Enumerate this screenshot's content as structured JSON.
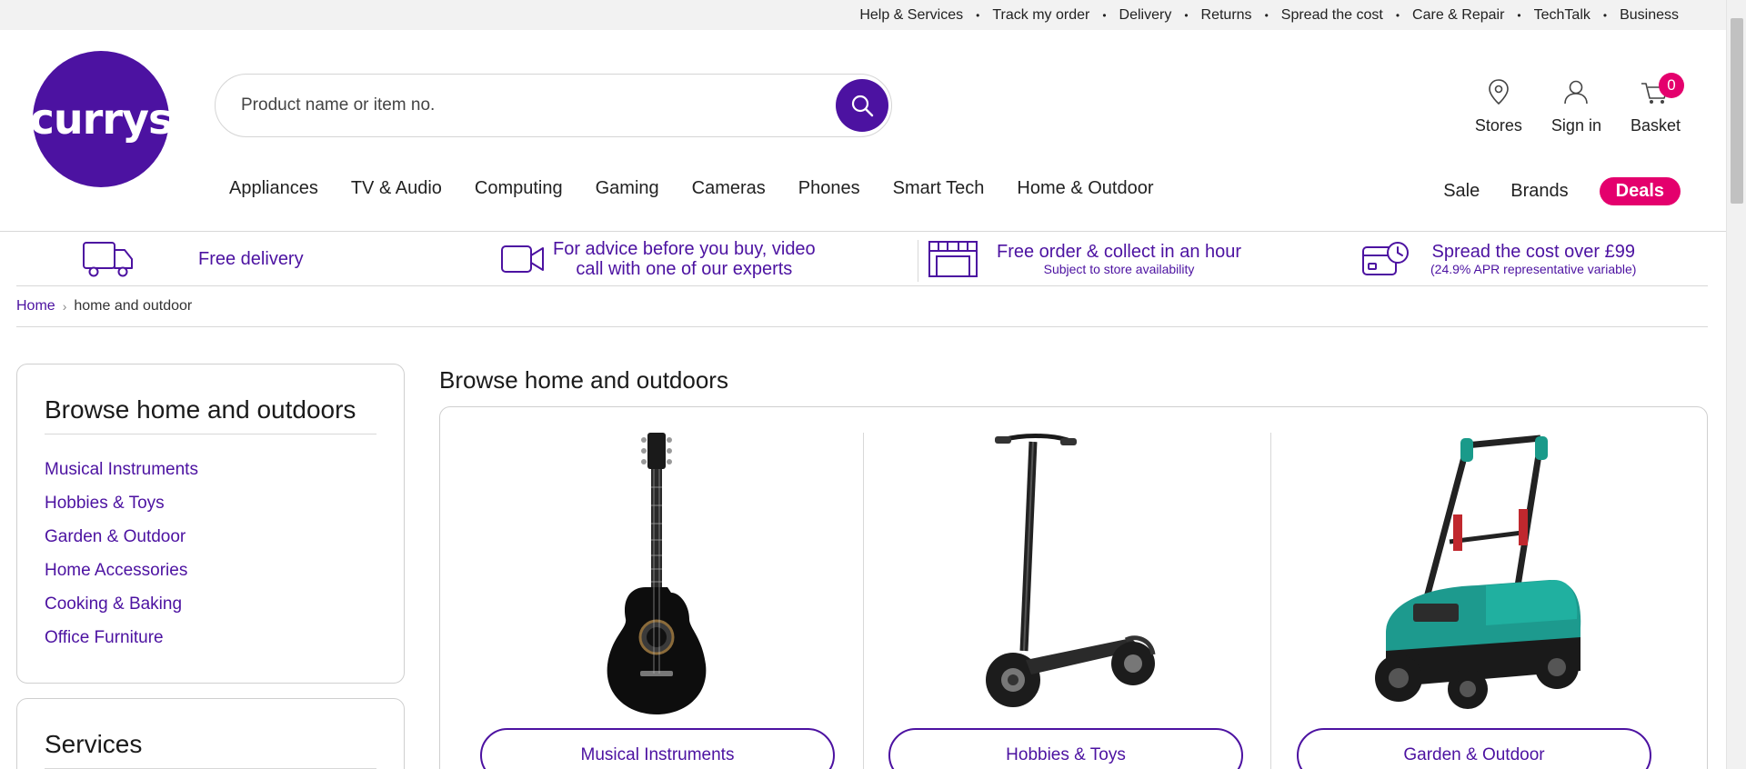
{
  "topbar": {
    "links": [
      "Help & Services",
      "Track my order",
      "Delivery",
      "Returns",
      "Spread the cost",
      "Care & Repair",
      "TechTalk",
      "Business"
    ]
  },
  "brand": {
    "logo_text": "currys",
    "color": "#4c12a1",
    "accent": "#e4006d"
  },
  "search": {
    "placeholder": "Product name or item no.",
    "value": ""
  },
  "header_actions": {
    "stores": "Stores",
    "sign_in": "Sign in",
    "basket": "Basket",
    "basket_count": "0"
  },
  "nav": {
    "items": [
      "Appliances",
      "TV & Audio",
      "Computing",
      "Gaming",
      "Cameras",
      "Phones",
      "Smart Tech",
      "Home & Outdoor"
    ],
    "right": [
      "Sale",
      "Brands",
      "Deals"
    ]
  },
  "usp": {
    "delivery": "Free delivery",
    "advice_line1": "For advice before you buy, video",
    "advice_line2": "call with one of our experts",
    "collect_main": "Free order & collect in an hour",
    "collect_sub": "Subject to store availability",
    "spread_main": "Spread the cost over £99",
    "spread_sub": "(24.9% APR representative variable)"
  },
  "breadcrumb": {
    "home": "Home",
    "current": "home and outdoor"
  },
  "sidebar": {
    "title": "Browse home and outdoors",
    "items": [
      "Musical Instruments",
      "Hobbies & Toys",
      "Garden & Outdoor",
      "Home Accessories",
      "Cooking & Baking",
      "Office Furniture"
    ],
    "services_title": "Services"
  },
  "main": {
    "title": "Browse home and outdoors",
    "categories": [
      "Musical Instruments",
      "Hobbies & Toys",
      "Garden & Outdoor"
    ]
  }
}
